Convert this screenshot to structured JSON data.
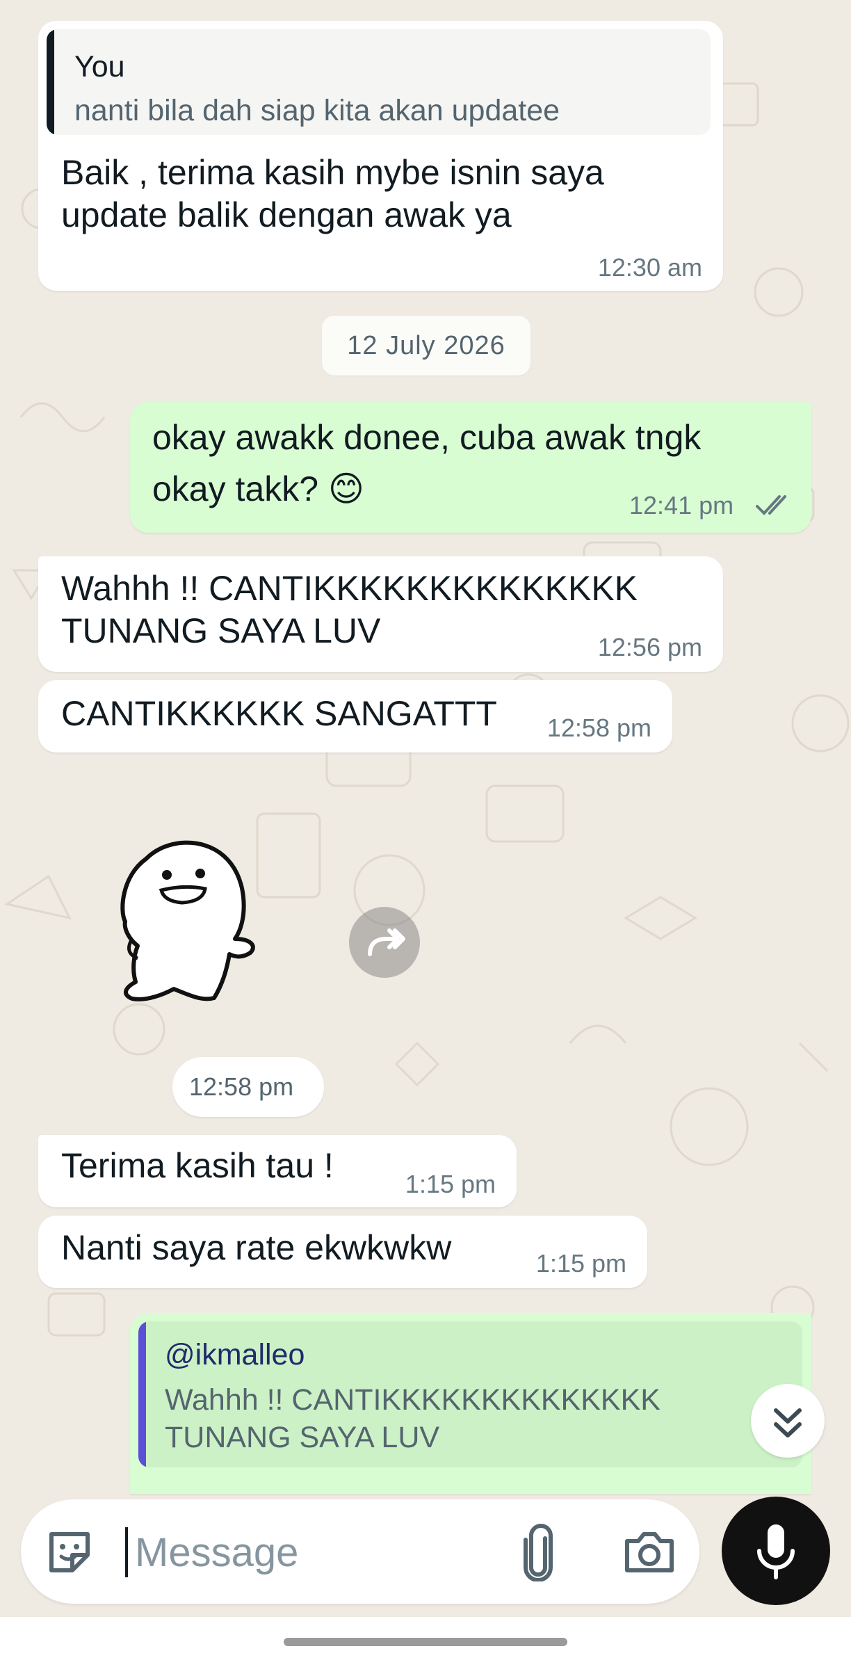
{
  "colors": {
    "background": "#efeae2",
    "incoming_bubble": "#ffffff",
    "outgoing_bubble": "#d9fdd3",
    "timestamp": "#667781",
    "read_ticks": "#667781",
    "quote_bar_self": "#111b21",
    "quote_bar_contact": "#5b4fd6",
    "quote_author_contact": "#1f2b6b"
  },
  "conversation": {
    "msg1": {
      "quote_author": "You",
      "quote_text": "nanti bila dah siap kita akan updatee",
      "text": "Baik , terima kasih mybe isnin saya\nupdate balik dengan awak ya",
      "time": "12:30 am"
    },
    "date_separator": "12 July 2026",
    "msg2": {
      "text": "okay awakk donee, cuba awak tngk\nokay takk? 😊",
      "time": "12:41 pm",
      "status_icon": "double-check-icon"
    },
    "msg3": {
      "text": "Wahhh !! CANTIKKKKKKKKKKKKKK\nTUNANG SAYA LUV",
      "time": "12:56 pm"
    },
    "msg4": {
      "text": "CANTIKKKKKK SANGATTT",
      "time": "12:58 pm"
    },
    "sticker": {
      "icon": "sticker-character-icon",
      "forward_icon": "forward-icon",
      "time": "12:58 pm"
    },
    "msg5": {
      "text": "Terima kasih tau !",
      "time": "1:15 pm"
    },
    "msg6": {
      "text": "Nanti saya rate ekwkwkw",
      "time": "1:15 pm"
    },
    "msg7": {
      "quote_author": "@ikmalleo",
      "quote_text": "Wahhh !! CANTIKKKKKKKKKKKKKK\nTUNANG SAYA LUV"
    }
  },
  "scroll_down_icon": "double-chevron-down-icon",
  "composer": {
    "placeholder": "Message",
    "value": "",
    "emoji_icon": "sticker-emoji-icon",
    "attach_icon": "paperclip-icon",
    "camera_icon": "camera-icon",
    "mic_icon": "microphone-icon"
  }
}
